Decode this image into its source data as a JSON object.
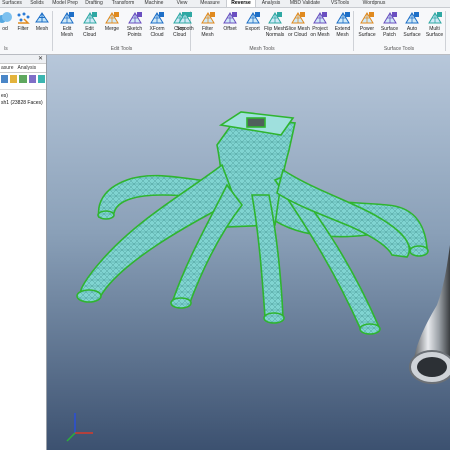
{
  "ribbon": {
    "tabs": [
      "Surfaces",
      "Solids",
      "Model Prep",
      "Drafting",
      "Transform",
      "Machine",
      "View",
      "Measure",
      "Reverse",
      "Analysis",
      "MBD Validate",
      "VSTools",
      "Wordpnus"
    ],
    "active_tab": "Reverse",
    "groups": [
      {
        "label": "Edit Tools",
        "tools": [
          {
            "label": "Edit\nMesh",
            "icon": "edit-mesh-icon"
          },
          {
            "label": "Edit\nCloud",
            "icon": "edit-cloud-icon"
          },
          {
            "label": "Merge",
            "icon": "merge-icon"
          },
          {
            "label": "Sketch\nPoints",
            "icon": "sketch-points-icon"
          },
          {
            "label": "XForm\nCloud",
            "icon": "xform-cloud-icon"
          },
          {
            "label": "Crop\nCloud",
            "icon": "crop-cloud-icon"
          }
        ]
      },
      {
        "label": "Mesh Tools",
        "tools": [
          {
            "label": "Smooth",
            "icon": "smooth-icon"
          },
          {
            "label": "Filter\nMesh",
            "icon": "filter-mesh-icon"
          },
          {
            "label": "Offset",
            "icon": "offset-icon"
          },
          {
            "label": "Export",
            "icon": "export-icon"
          },
          {
            "label": "Flip Mesh\nNormals",
            "icon": "flip-normals-icon"
          },
          {
            "label": "Slice Mesh\nor Cloud",
            "icon": "slice-mesh-icon"
          },
          {
            "label": "Project\non Mesh",
            "icon": "project-mesh-icon"
          },
          {
            "label": "Extend\nMesh",
            "icon": "extend-mesh-icon"
          }
        ]
      },
      {
        "label": "Surface Tools",
        "tools": [
          {
            "label": "Power\nSurface",
            "icon": "power-surface-icon"
          },
          {
            "label": "Surface\nPatch",
            "icon": "surface-patch-icon"
          },
          {
            "label": "Auto\nSurface",
            "icon": "auto-surface-icon"
          },
          {
            "label": "Multi\nSurface",
            "icon": "multi-surface-icon"
          }
        ]
      }
    ],
    "left_partial": {
      "tools": [
        {
          "label": "Filter",
          "icon": "filter-icon"
        },
        {
          "label": "Mesh",
          "icon": "mesh-icon"
        }
      ],
      "cut_label": "od",
      "group_label": "ls"
    }
  },
  "left_panel": {
    "pin_symbol": "✕",
    "tabs": [
      "asure",
      "Analysis"
    ],
    "tree_lines": [
      "es)",
      "sh1 (23828 Faces)"
    ]
  },
  "colors": {
    "mesh_fill": "#7fd3d0",
    "mesh_edge": "#2fb52f",
    "viewport_top": "#b7c7da",
    "viewport_bottom": "#3c5170",
    "ribbon_bg": "#f7f8fa"
  }
}
